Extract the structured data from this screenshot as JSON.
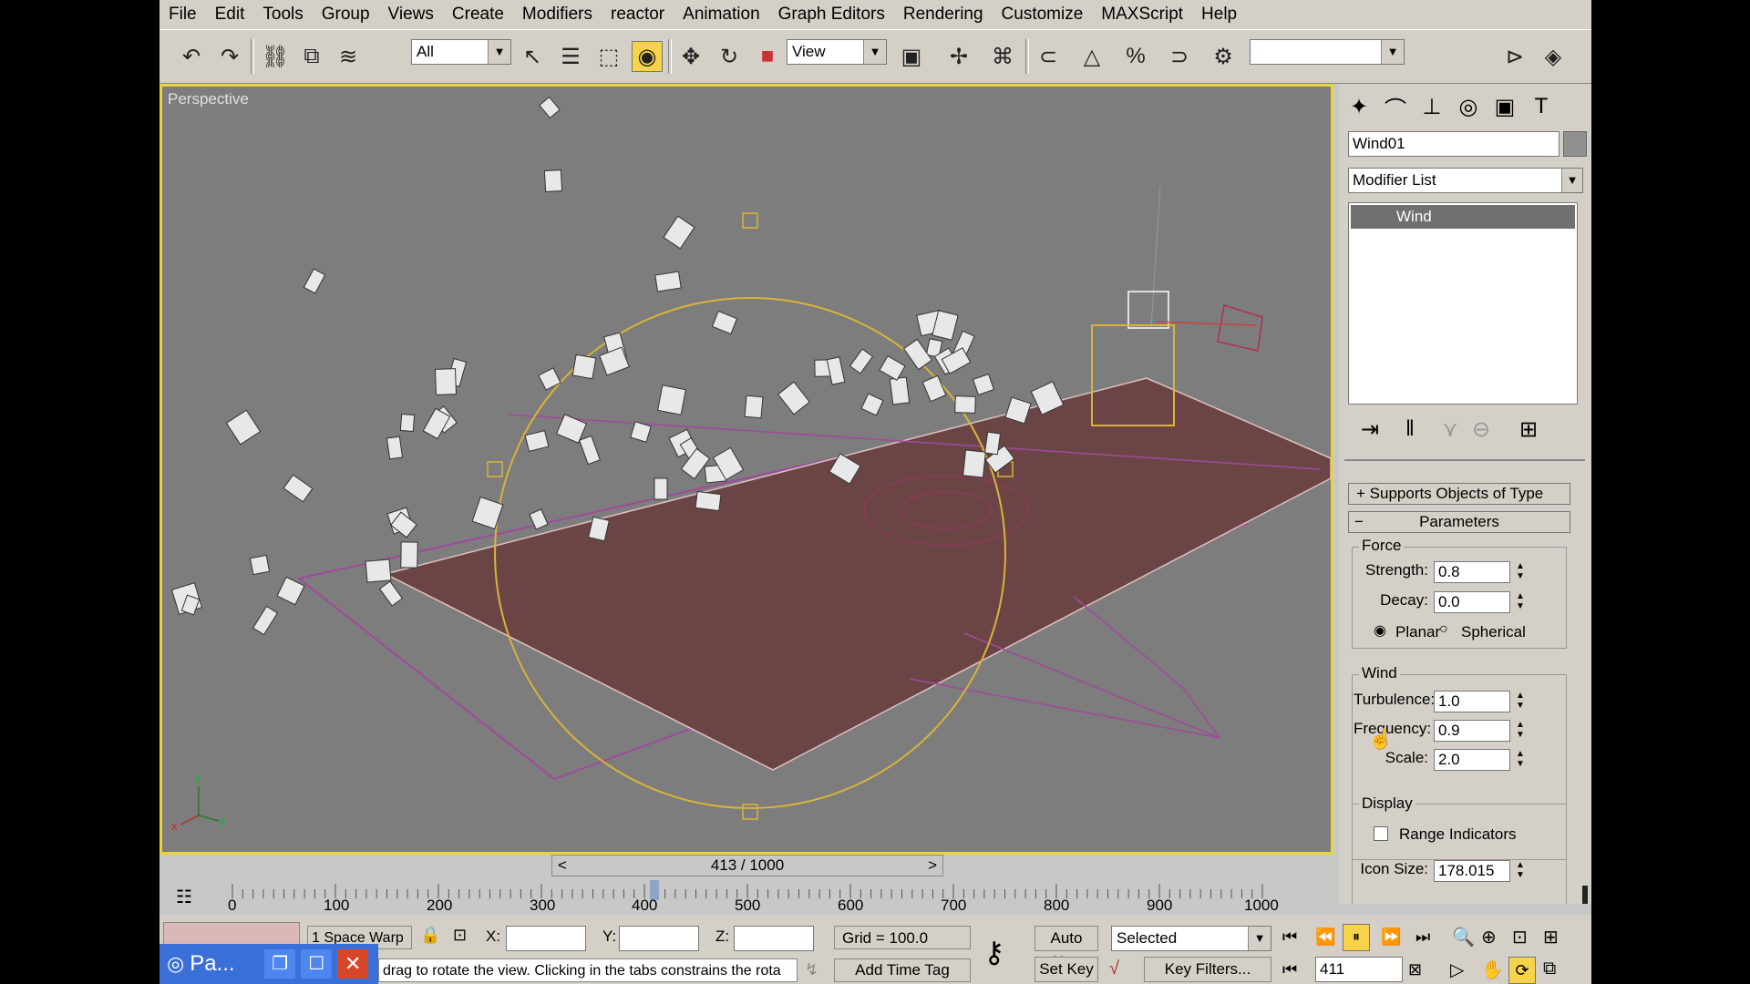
{
  "menu": [
    "File",
    "Edit",
    "Tools",
    "Group",
    "Views",
    "Create",
    "Modifiers",
    "reactor",
    "Animation",
    "Graph Editors",
    "Rendering",
    "Customize",
    "MAXScript",
    "Help"
  ],
  "toolbar": {
    "selection_filter": "All",
    "ref_coord": "View",
    "named_selection": ""
  },
  "viewport": {
    "label": "Perspective"
  },
  "command_panel": {
    "object_name": "Wind01",
    "modifier_list": "Modifier List",
    "stack_item": "Wind",
    "rollout_supports": "Supports Objects of Type",
    "rollout_params": "Parameters",
    "force": {
      "group": "Force",
      "strength_label": "Strength:",
      "strength": "0.8",
      "decay_label": "Decay:",
      "decay": "0.0",
      "planar": "Planar",
      "spherical": "Spherical"
    },
    "wind": {
      "group": "Wind",
      "turbulence_label": "Turbulence:",
      "turbulence": "1.0",
      "frequency_label": "Frequency:",
      "frequency": "0.9",
      "scale_label": "Scale:",
      "scale": "2.0"
    },
    "display": {
      "group": "Display",
      "range_indicators": "Range Indicators",
      "icon_size_label": "Icon Size:",
      "icon_size": "178.015"
    }
  },
  "timeslider": {
    "value": "413 / 1000"
  },
  "trackbar": {
    "ticks": [
      "0",
      "100",
      "200",
      "300",
      "400",
      "500",
      "600",
      "700",
      "800",
      "900",
      "1000"
    ]
  },
  "status": {
    "selection": "1 Space Warp",
    "x_label": "X:",
    "y_label": "Y:",
    "z_label": "Z:",
    "grid": "Grid = 100.0",
    "prompt": "drag to rotate the view. Clicking in the tabs constrains the rota",
    "add_time_tag": "Add Time Tag",
    "auto_key": "Auto Key",
    "set_key": "Set Key",
    "selected": "Selected",
    "key_filters": "Key Filters...",
    "frame": "411"
  },
  "taskbar": {
    "label": "Pa..."
  },
  "colors": {
    "accent": "#e8d53c",
    "floor": "#6b4545",
    "gizmo": "#d8b43a"
  }
}
